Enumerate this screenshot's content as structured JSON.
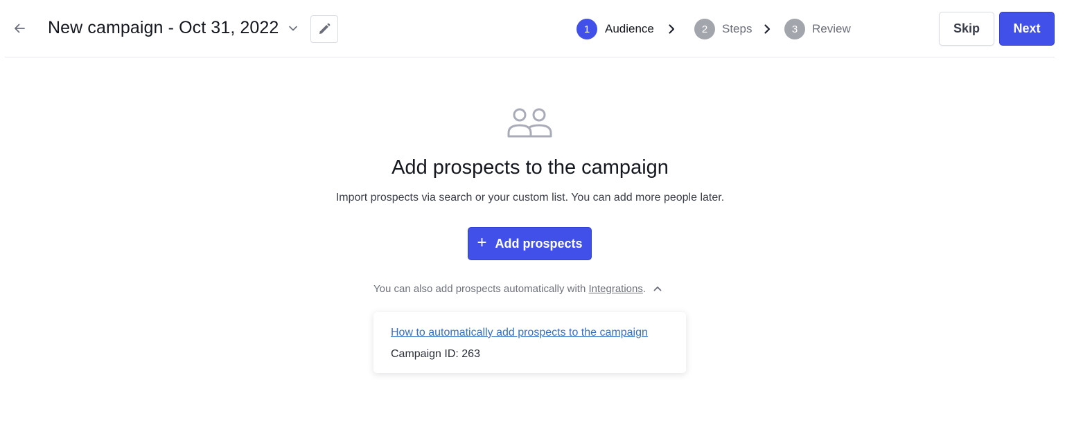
{
  "header": {
    "back_icon": "arrow-left-icon",
    "title": "New campaign - Oct 31, 2022",
    "title_dropdown_icon": "chevron-down-icon",
    "edit_icon": "pencil-icon"
  },
  "stepper": {
    "steps": [
      {
        "number": "1",
        "label": "Audience",
        "state": "active"
      },
      {
        "number": "2",
        "label": "Steps",
        "state": "inactive"
      },
      {
        "number": "3",
        "label": "Review",
        "state": "inactive"
      }
    ],
    "separator_icon": "chevron-right-icon"
  },
  "actions": {
    "skip_label": "Skip",
    "next_label": "Next"
  },
  "empty_state": {
    "icon": "people-icon",
    "heading": "Add prospects to the campaign",
    "subtext": "Import prospects via search or your custom list. You can add more people later.",
    "add_button_label": "Add prospects",
    "add_button_icon": "plus-icon",
    "integrations_prefix": "You can also add prospects automatically with ",
    "integrations_link": "Integrations",
    "integrations_suffix": ".",
    "collapse_icon": "chevron-up-icon"
  },
  "info_card": {
    "help_link": "How to automatically add prospects to the campaign",
    "campaign_id_text": "Campaign ID: 263"
  },
  "colors": {
    "primary": "#4150e8",
    "step_active": "#4150e8",
    "step_inactive": "#a3a5ad",
    "link": "#3571c9",
    "icon_gray": "#a9acb8"
  }
}
